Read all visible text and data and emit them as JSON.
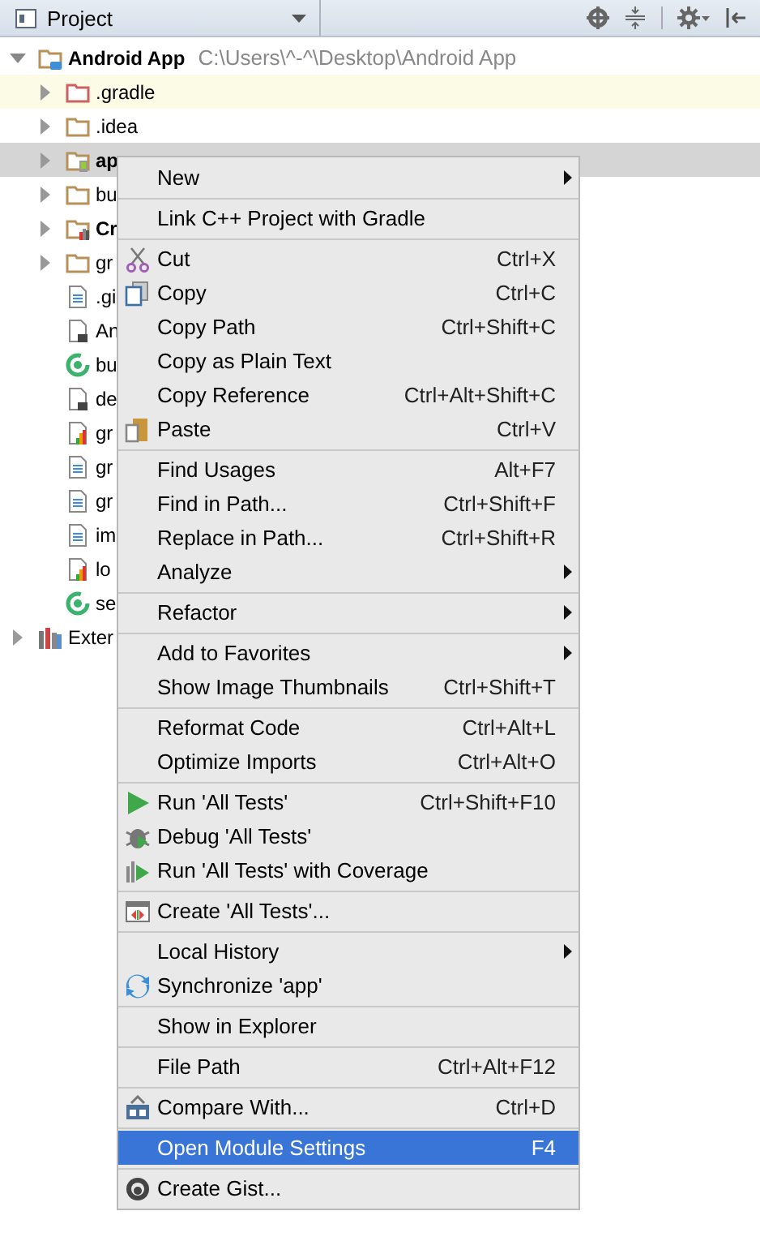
{
  "panel": {
    "title": "Project"
  },
  "tree": [
    {
      "label": "Android App",
      "path": "C:\\Users\\^-^\\Desktop\\Android App",
      "kind": "module",
      "bold": true,
      "expanded": true,
      "selected": false,
      "highlighted": false,
      "children": [
        {
          "label": ".gradle",
          "kind": "excluded-folder",
          "bold": false,
          "expanded": false,
          "selected": false,
          "highlighted": true
        },
        {
          "label": ".idea",
          "kind": "folder",
          "bold": false,
          "expanded": false,
          "selected": false,
          "highlighted": false
        },
        {
          "label": "ap",
          "kind": "module-folder",
          "bold": true,
          "expanded": false,
          "selected": true,
          "highlighted": false
        },
        {
          "label": "bu",
          "kind": "folder",
          "bold": false,
          "expanded": false,
          "selected": false,
          "highlighted": false
        },
        {
          "label": "Cr",
          "kind": "chart-folder",
          "bold": true,
          "expanded": false,
          "selected": false,
          "highlighted": false
        },
        {
          "label": "gr",
          "kind": "folder",
          "bold": false,
          "expanded": false,
          "selected": false,
          "highlighted": false
        },
        {
          "label": ".gi",
          "kind": "text-file",
          "bold": false,
          "selected": false,
          "highlighted": false
        },
        {
          "label": "An",
          "kind": "dark-file",
          "bold": false,
          "selected": false,
          "highlighted": false
        },
        {
          "label": "bu",
          "kind": "gradle-file",
          "bold": false,
          "selected": false,
          "highlighted": false
        },
        {
          "label": "de",
          "kind": "dark-file",
          "bold": false,
          "selected": false,
          "highlighted": false
        },
        {
          "label": "gr",
          "kind": "chart-file",
          "bold": false,
          "selected": false,
          "highlighted": false
        },
        {
          "label": "gr",
          "kind": "text-file",
          "bold": false,
          "selected": false,
          "highlighted": false
        },
        {
          "label": "gr",
          "kind": "text-file",
          "bold": false,
          "selected": false,
          "highlighted": false
        },
        {
          "label": "im",
          "kind": "text-file",
          "bold": false,
          "selected": false,
          "highlighted": false
        },
        {
          "label": "lo",
          "kind": "chart-file",
          "bold": false,
          "selected": false,
          "highlighted": false
        },
        {
          "label": "se",
          "kind": "gradle-file",
          "bold": false,
          "selected": false,
          "highlighted": false
        }
      ]
    },
    {
      "label": "Exter",
      "kind": "library",
      "bold": false,
      "expanded": false,
      "selected": false,
      "highlighted": false
    }
  ],
  "menu": [
    [
      {
        "label": "New",
        "submenu": true,
        "selected": false
      }
    ],
    [
      {
        "label": "Link C++ Project with Gradle",
        "submenu": false,
        "selected": false
      }
    ],
    [
      {
        "label": "Cut",
        "shortcut": "Ctrl+X",
        "kind": "cut",
        "submenu": false,
        "selected": false
      },
      {
        "label": "Copy",
        "shortcut": "Ctrl+C",
        "kind": "copy",
        "submenu": false,
        "selected": false
      },
      {
        "label": "Copy Path",
        "shortcut": "Ctrl+Shift+C",
        "submenu": false,
        "selected": false
      },
      {
        "label": "Copy as Plain Text",
        "submenu": false,
        "selected": false
      },
      {
        "label": "Copy Reference",
        "shortcut": "Ctrl+Alt+Shift+C",
        "submenu": false,
        "selected": false
      },
      {
        "label": "Paste",
        "shortcut": "Ctrl+V",
        "kind": "paste",
        "submenu": false,
        "selected": false
      }
    ],
    [
      {
        "label": "Find Usages",
        "shortcut": "Alt+F7",
        "submenu": false,
        "selected": false
      },
      {
        "label": "Find in Path...",
        "shortcut": "Ctrl+Shift+F",
        "submenu": false,
        "selected": false
      },
      {
        "label": "Replace in Path...",
        "shortcut": "Ctrl+Shift+R",
        "submenu": false,
        "selected": false
      },
      {
        "label": "Analyze",
        "submenu": true,
        "selected": false
      }
    ],
    [
      {
        "label": "Refactor",
        "submenu": true,
        "selected": false
      }
    ],
    [
      {
        "label": "Add to Favorites",
        "submenu": true,
        "selected": false
      },
      {
        "label": "Show Image Thumbnails",
        "shortcut": "Ctrl+Shift+T",
        "submenu": false,
        "selected": false
      }
    ],
    [
      {
        "label": "Reformat Code",
        "shortcut": "Ctrl+Alt+L",
        "submenu": false,
        "selected": false
      },
      {
        "label": "Optimize Imports",
        "shortcut": "Ctrl+Alt+O",
        "submenu": false,
        "selected": false
      }
    ],
    [
      {
        "label": "Run 'All Tests'",
        "shortcut": "Ctrl+Shift+F10",
        "kind": "run",
        "submenu": false,
        "selected": false
      },
      {
        "label": "Debug 'All Tests'",
        "kind": "debug",
        "submenu": false,
        "selected": false
      },
      {
        "label": "Run 'All Tests' with Coverage",
        "kind": "coverage",
        "submenu": false,
        "selected": false
      }
    ],
    [
      {
        "label": "Create 'All Tests'...",
        "kind": "create-test",
        "submenu": false,
        "selected": false
      }
    ],
    [
      {
        "label": "Local History",
        "submenu": true,
        "selected": false
      },
      {
        "label": "Synchronize 'app'",
        "kind": "sync",
        "submenu": false,
        "selected": false
      }
    ],
    [
      {
        "label": "Show in Explorer",
        "submenu": false,
        "selected": false
      }
    ],
    [
      {
        "label": "File Path",
        "shortcut": "Ctrl+Alt+F12",
        "submenu": false,
        "selected": false
      }
    ],
    [
      {
        "label": "Compare With...",
        "shortcut": "Ctrl+D",
        "kind": "compare",
        "submenu": false,
        "selected": false
      }
    ],
    [
      {
        "label": "Open Module Settings",
        "shortcut": "F4",
        "submenu": false,
        "selected": true
      }
    ],
    [
      {
        "label": "Create Gist...",
        "kind": "gist",
        "submenu": false,
        "selected": false
      }
    ]
  ]
}
